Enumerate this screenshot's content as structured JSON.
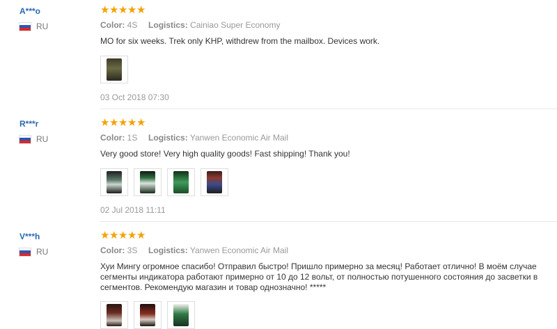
{
  "reviews": [
    {
      "user": "A***o",
      "country": "RU",
      "rating": 5,
      "color_label": "Color:",
      "color_value": "4S",
      "logistics_label": "Logistics:",
      "logistics_value": "Cainiao Super Economy",
      "text": "MO for six weeks. Trek only KHP, withdrew from the mailbox. Devices work.",
      "photos": 1,
      "date": "03 Oct 2018 07:30"
    },
    {
      "user": "R***r",
      "country": "RU",
      "rating": 5,
      "color_label": "Color:",
      "color_value": "1S",
      "logistics_label": "Logistics:",
      "logistics_value": "Yanwen Economic Air Mail",
      "text": "Very good store! Very high quality goods! Fast shipping! Thank you!",
      "photos": 4,
      "date": "02 Jul 2018 11:11"
    },
    {
      "user": "V***h",
      "country": "RU",
      "rating": 5,
      "color_label": "Color:",
      "color_value": "3S",
      "logistics_label": "Logistics:",
      "logistics_value": "Yanwen Economic Air Mail",
      "text_lines": [
        "Хуи Мингу огромное спасибо! Отправил быстро! Пришло примерно за месяц! Работает отлично! В моём случае",
        "сегменты индикатора работают примерно от 10 до 12 вольт, от полностью потушенного состояния до засветки в",
        "сегментов. Рекомендую магазин и товар однозначно! *****"
      ],
      "photos": 3
    }
  ],
  "colors": {
    "username": "#2b67b5",
    "star": "#f5a100",
    "meta_text": "#999999",
    "body_text": "#333333"
  },
  "icons": {
    "rating": "star-icon",
    "flag": "russia-flag-icon"
  }
}
